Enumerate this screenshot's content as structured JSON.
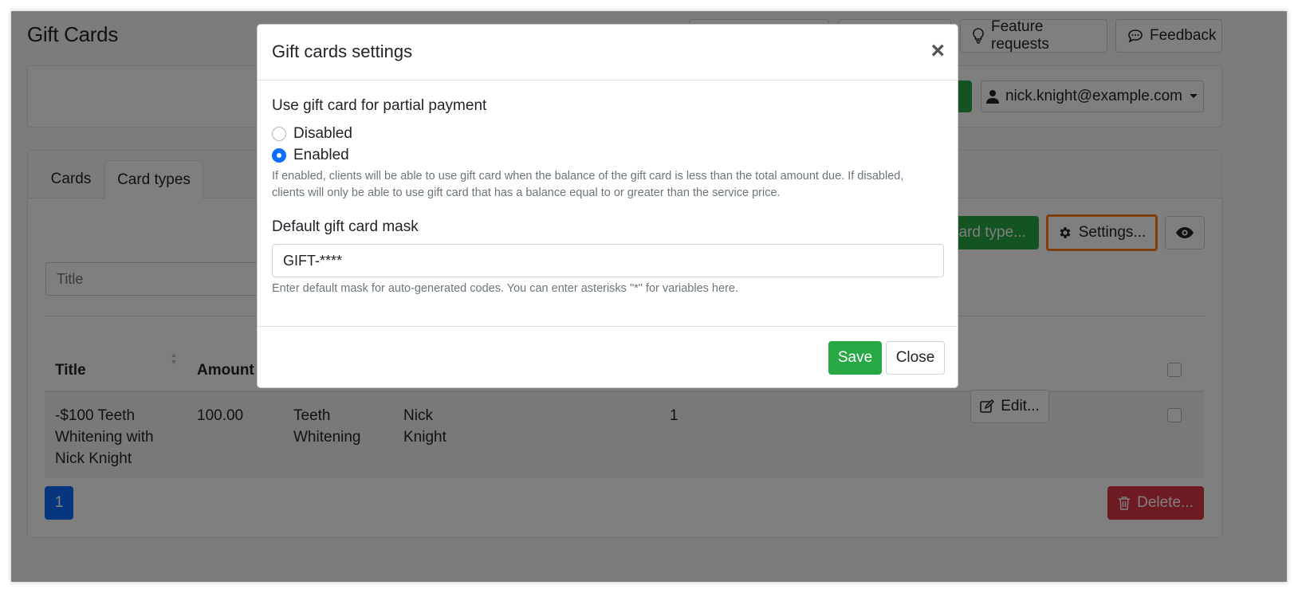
{
  "page": {
    "title": "Gift Cards"
  },
  "header": {
    "feature_requests": "Feature requests",
    "feedback": "Feedback",
    "user_email": "nick.knight@example.com"
  },
  "tabs": [
    {
      "label": "Cards"
    },
    {
      "label": "Card types"
    }
  ],
  "toolbar": {
    "add_card_type_partial": "card type...",
    "settings_label": "Settings..."
  },
  "filter": {
    "title_placeholder": "Title"
  },
  "table": {
    "headers": {
      "title": "Title",
      "amount": "Amount"
    },
    "rows": [
      {
        "title_lines": [
          "-$100 Teeth",
          "Whitening with",
          "Nick Knight"
        ],
        "amount": "100.00",
        "service_lines": [
          "Teeth",
          "Whitening"
        ],
        "staff_lines": [
          "Nick",
          "Knight"
        ],
        "count": "1",
        "edit_label": "Edit..."
      }
    ]
  },
  "pagination": {
    "current_page": "1"
  },
  "bulk": {
    "delete_label": "Delete..."
  },
  "modal": {
    "title": "Gift cards settings",
    "close_symbol": "×",
    "partial_payment": {
      "label": "Use gift card for partial payment",
      "options": [
        {
          "label": "Disabled",
          "checked": false
        },
        {
          "label": "Enabled",
          "checked": true
        }
      ],
      "help_line1": "If enabled, clients will be able to use gift card when the balance of the gift card is less than the total amount due. If disabled,",
      "help_line2": "clients will only be able to use gift card that has a balance equal to or greater than the service price."
    },
    "mask": {
      "label": "Default gift card mask",
      "value": "GIFT-****",
      "help": "Enter default mask for auto-generated codes. You can enter asterisks \"*\" for variables here."
    },
    "save_label": "Save",
    "close_label": "Close"
  },
  "colors": {
    "primary": "#0d6efd",
    "success": "#28a745",
    "danger": "#dc3545",
    "highlight": "#fd7e14"
  }
}
